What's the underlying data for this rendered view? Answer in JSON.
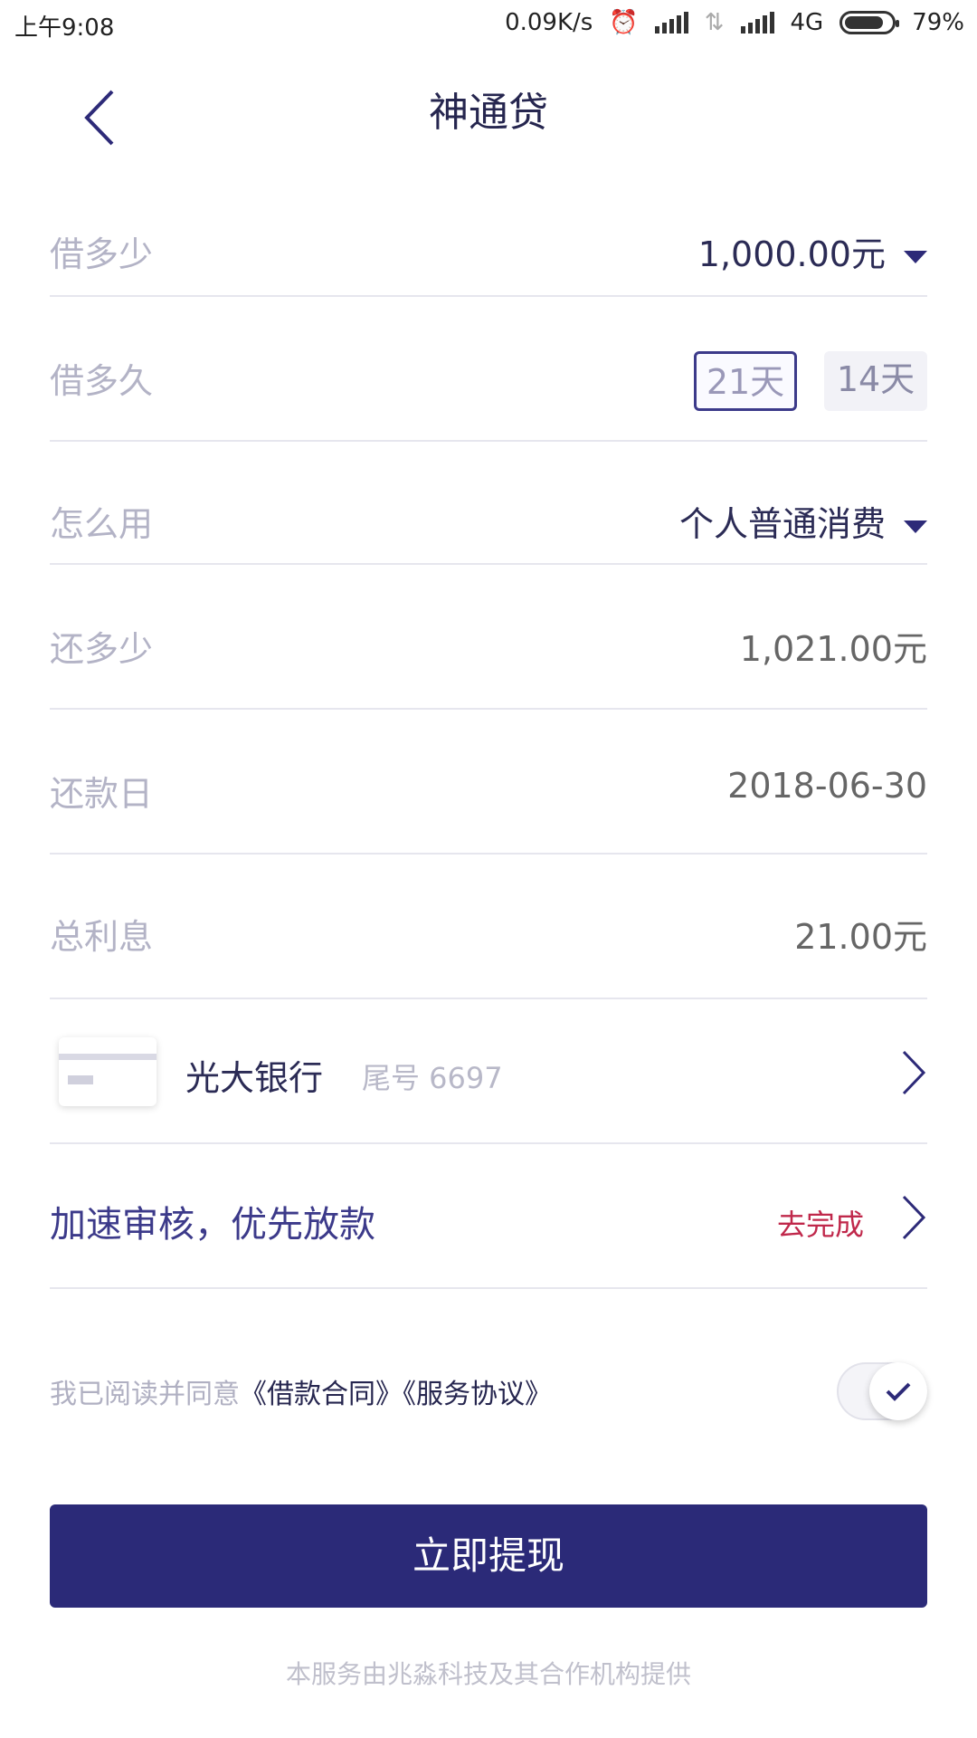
{
  "status_bar": {
    "time": "上午9:08",
    "speed": "0.09K/s",
    "network": "4G",
    "battery": "79%"
  },
  "nav": {
    "title": "神通贷"
  },
  "form": {
    "amount": {
      "label": "借多少",
      "value": "1,000.00元"
    },
    "duration": {
      "label": "借多久",
      "options": [
        "21天",
        "14天"
      ],
      "selected": "21天"
    },
    "usage": {
      "label": "怎么用",
      "value": "个人普通消费"
    },
    "repay": {
      "label": "还多少",
      "value": "1,021.00元"
    },
    "repay_date": {
      "label": "还款日",
      "value": "2018-06-30"
    },
    "interest": {
      "label": "总利息",
      "value": "21.00元"
    }
  },
  "bank": {
    "name": "光大银行",
    "tail": "尾号 6697"
  },
  "accelerate": {
    "label": "加速审核，优先放款",
    "action": "去完成",
    "action_color": "#c0284b"
  },
  "agreement": {
    "prefix": "我已阅读并同意",
    "contract": "《借款合同》",
    "service": "《服务协议》",
    "checked": true
  },
  "submit": {
    "label": "立即提现"
  },
  "footer": {
    "text": "本服务由兆淼科技及其合作机构提供"
  },
  "colors": {
    "primary": "#2b2a78",
    "label": "#b3b3c6",
    "value_dark": "#2b2b55"
  }
}
